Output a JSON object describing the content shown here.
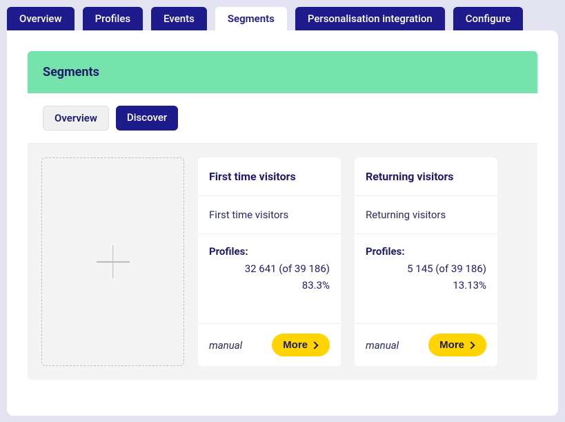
{
  "tabs": {
    "overview": "Overview",
    "profiles": "Profiles",
    "events": "Events",
    "segments": "Segments",
    "personalisation": "Personalisation integration",
    "configure": "Configure"
  },
  "panel": {
    "title": "Segments"
  },
  "subtabs": {
    "overview": "Overview",
    "discover": "Discover"
  },
  "segments": [
    {
      "title": "First time visitors",
      "description": "First time visitors",
      "profiles_label": "Profiles:",
      "count_line": "32 641 (of 39 186)",
      "pct_line": "83.3%",
      "type": "manual",
      "more": "More"
    },
    {
      "title": "Returning visitors",
      "description": "Returning visitors",
      "profiles_label": "Profiles:",
      "count_line": "5 145 (of 39 186)",
      "pct_line": "13.13%",
      "type": "manual",
      "more": "More"
    }
  ]
}
